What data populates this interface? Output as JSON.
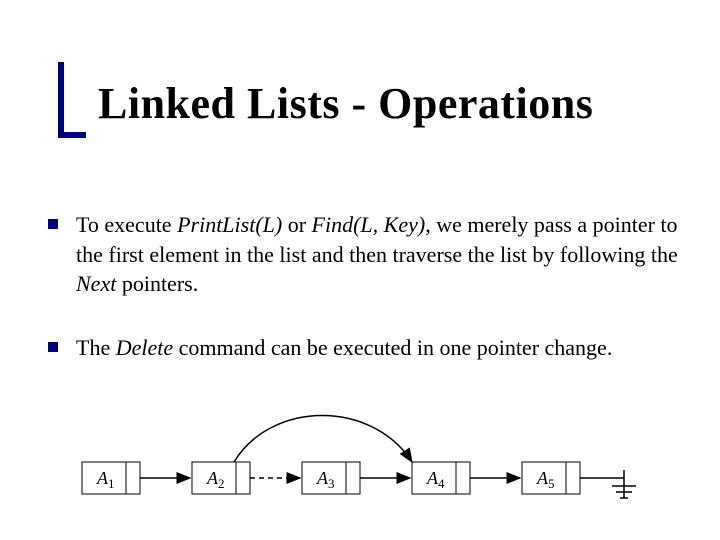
{
  "title": "Linked Lists - Operations",
  "bullets": {
    "b1": {
      "pre": "To execute ",
      "f1": "PrintList(L)",
      "mid1": " or ",
      "f2": "Find(L, Key)",
      "mid2": ", we merely pass a pointer to the first element in the list and then traverse the list by following the ",
      "f3": "Next",
      "post": " pointers."
    },
    "b2": {
      "pre": "The ",
      "f1": "Delete",
      "post": " command can be executed in one pointer change."
    }
  },
  "nodes": {
    "a1": {
      "base": "A",
      "sub": "1"
    },
    "a2": {
      "base": "A",
      "sub": "2"
    },
    "a3": {
      "base": "A",
      "sub": "3"
    },
    "a4": {
      "base": "A",
      "sub": "4"
    },
    "a5": {
      "base": "A",
      "sub": "5"
    }
  }
}
